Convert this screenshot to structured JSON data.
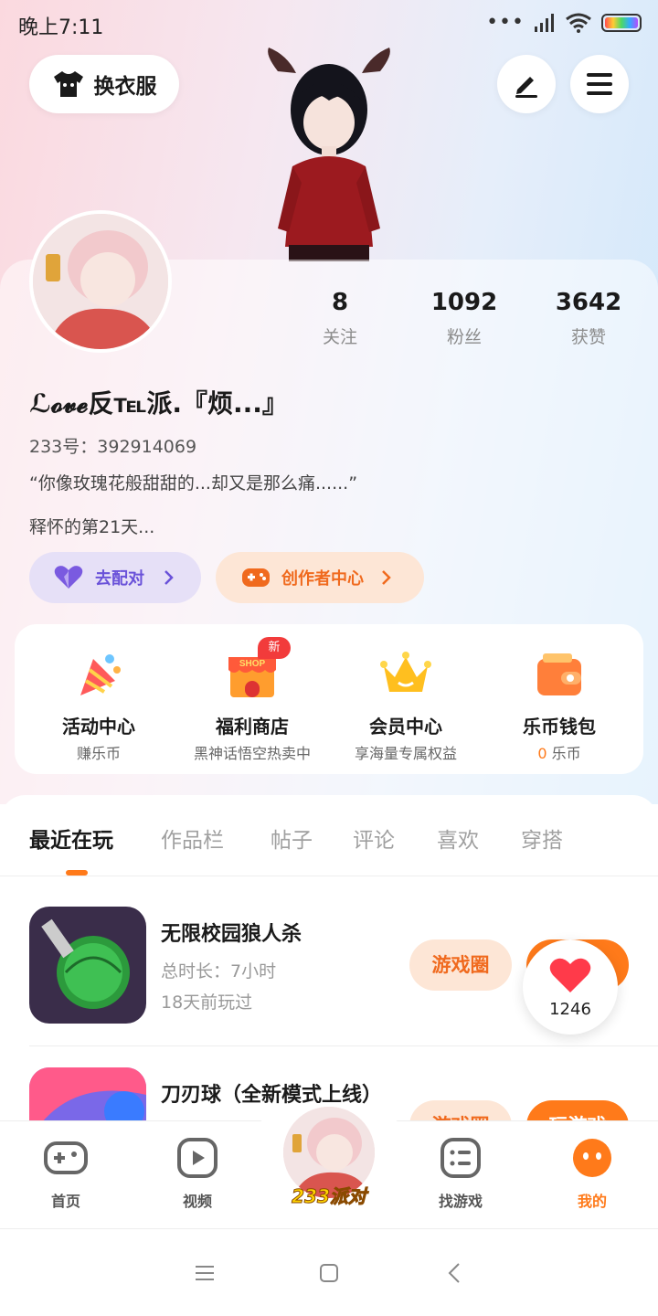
{
  "status_bar": {
    "time": "晚上7:11",
    "dots": "•••"
  },
  "header": {
    "outfit_label": "换衣服"
  },
  "stats": [
    {
      "value": "8",
      "label": "关注"
    },
    {
      "value": "1092",
      "label": "粉丝"
    },
    {
      "value": "3642",
      "label": "获赞"
    }
  ],
  "profile": {
    "nickname": "ℒ𝓸𝓿𝓮反℡派.『烦...』",
    "uid": "233号：392914069",
    "bio": "“你像玫瑰花般甜甜的...却又是那么痛......”",
    "days": "释怀的第21天..."
  },
  "actions": {
    "match_label": "去配对",
    "creator_label": "创作者中心"
  },
  "services": [
    {
      "title": "活动中心",
      "sub": "赚乐币",
      "icon": "party-popper-icon"
    },
    {
      "title": "福利商店",
      "sub": "黑神话悟空热卖中",
      "icon": "shop-icon",
      "badge": "新",
      "icon_text": "SHOP"
    },
    {
      "title": "会员中心",
      "sub": "享海量专属权益",
      "icon": "crown-icon"
    },
    {
      "title": "乐币钱包",
      "sub_value": "0",
      "sub_unit": " 乐币",
      "icon": "wallet-icon"
    }
  ],
  "tabs": [
    "最近在玩",
    "作品栏",
    "帖子",
    "评论",
    "喜欢",
    "穿搭"
  ],
  "games": [
    {
      "title": "无限校园狼人杀",
      "duration": "总时长：7小时",
      "last_played": "18天前玩过",
      "circle_label": "游戏圈",
      "play_label": "玩游戏"
    },
    {
      "title": "刀刃球（全新模式上线）",
      "circle_label": "游戏圈",
      "play_label": "玩游戏"
    }
  ],
  "like_bubble": {
    "count": "1246"
  },
  "bottom_nav": [
    {
      "label": "首页",
      "icon": "gamepad-icon"
    },
    {
      "label": "视频",
      "icon": "play-icon"
    },
    {
      "label": "233派对",
      "icon": "party-avatar"
    },
    {
      "label": "找游戏",
      "icon": "list-icon"
    },
    {
      "label": "我的",
      "icon": "profile-face-icon"
    }
  ],
  "colors": {
    "accent": "#ff7a1a",
    "match": "#6a52d9",
    "badge": "#f23b3b"
  }
}
